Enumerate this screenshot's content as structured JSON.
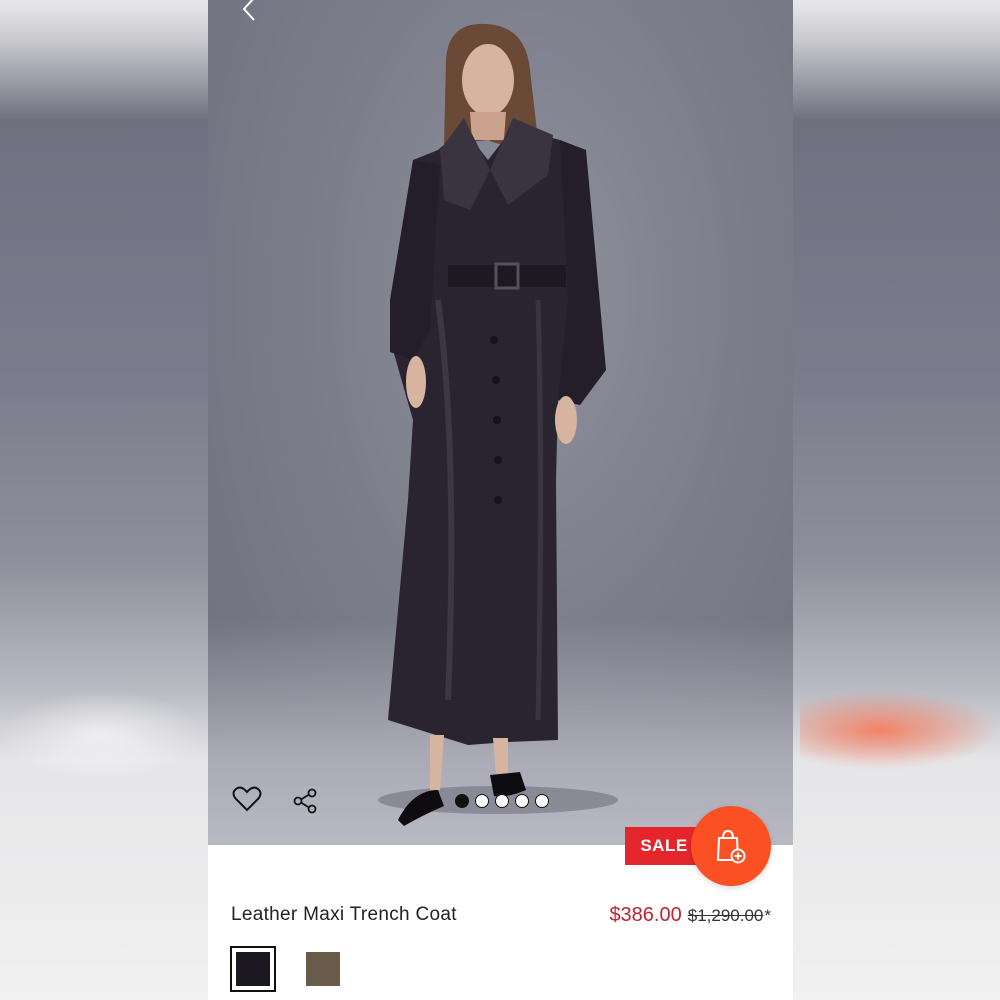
{
  "product": {
    "title": "Leather Maxi Trench Coat",
    "sale_price": "$386.00",
    "original_price": "$1,290.00",
    "price_note": "*",
    "badge": "SALE"
  },
  "gallery": {
    "image_count": 5,
    "active_index": 0
  },
  "swatches": [
    {
      "name": "Black",
      "color": "#1b1820",
      "selected": true
    },
    {
      "name": "Khaki",
      "color": "#6a5c4a",
      "selected": false
    }
  ],
  "icons": {
    "back": "chevron-left-icon",
    "wishlist": "heart-icon",
    "share": "share-icon",
    "add_to_bag": "shopping-bag-plus-icon"
  },
  "colors": {
    "sale_red": "#e4262c",
    "price_red": "#c2222f",
    "cta_orange": "#fb4f24"
  }
}
